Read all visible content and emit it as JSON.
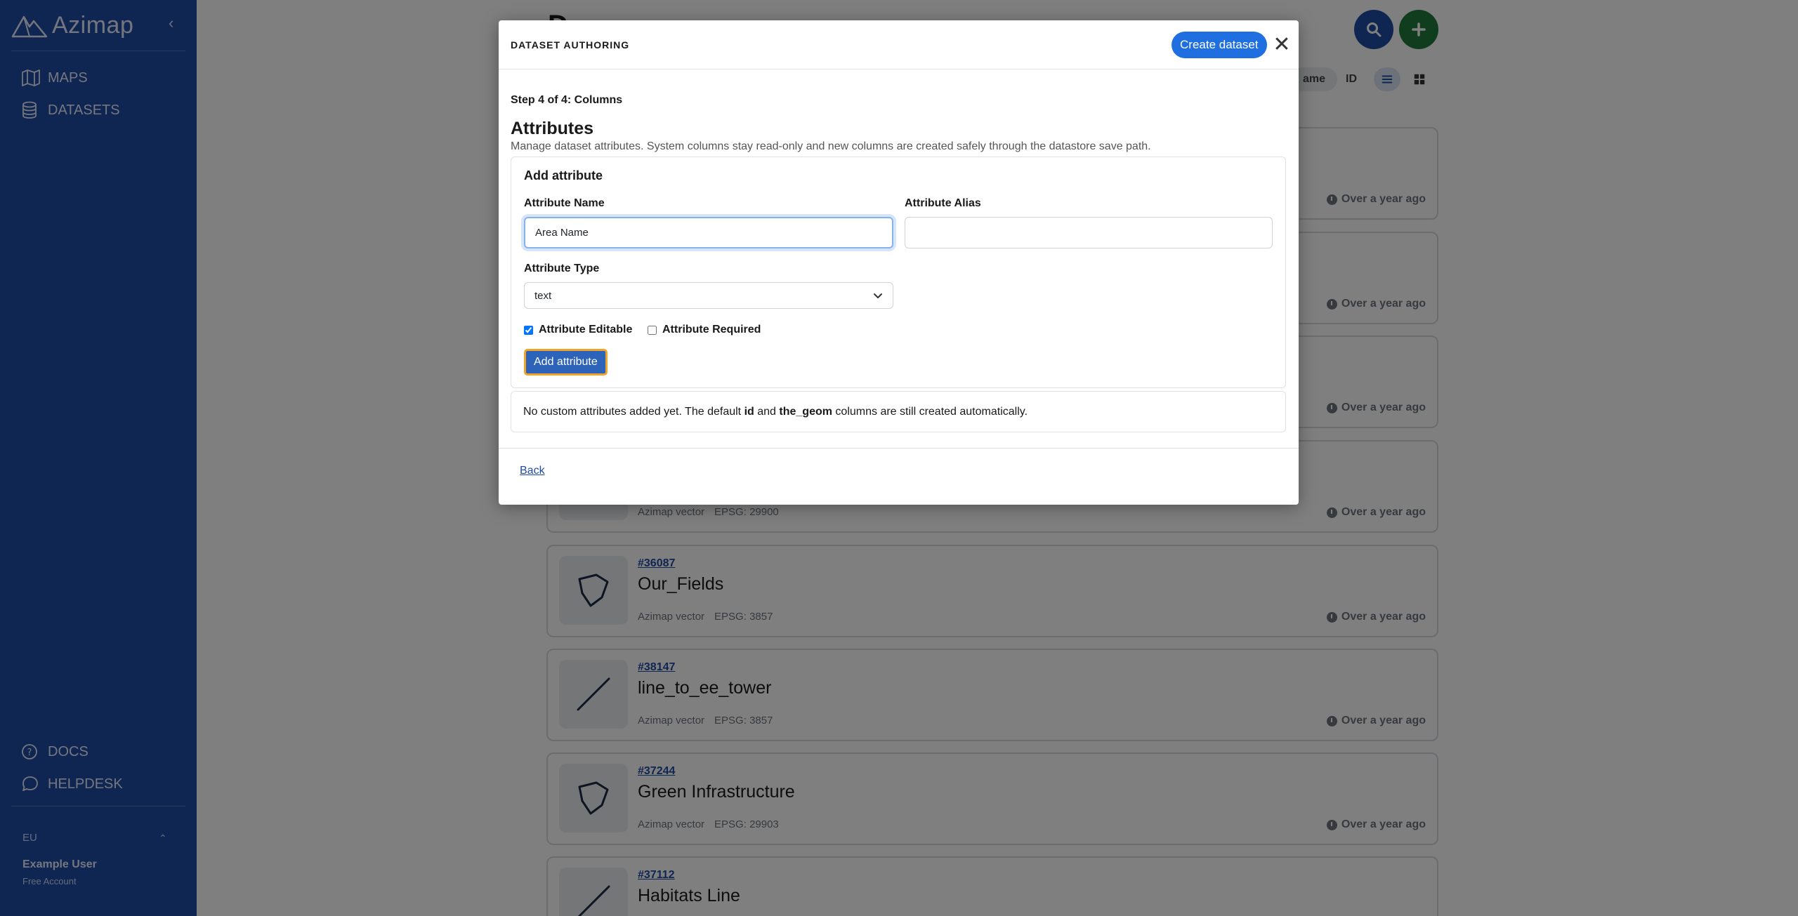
{
  "sidebar": {
    "brand": "Azimap",
    "nav": {
      "maps": "MAPS",
      "datasets": "DATASETS",
      "docs": "DOCS",
      "helpdesk": "HELPDESK"
    },
    "region": "EU",
    "user_name": "Example User",
    "user_plan": "Free Account"
  },
  "background": {
    "sort_name": "ame",
    "sort_id": "ID",
    "cards": [
      {
        "id": "",
        "title": "",
        "source": "",
        "epsg": "",
        "time": "Over a year ago",
        "geom": "polygon"
      },
      {
        "id": "",
        "title": "",
        "source": "",
        "epsg": "",
        "time": "Over a year ago",
        "geom": "polygon"
      },
      {
        "id": "",
        "title": "",
        "source": "",
        "epsg": "",
        "time": "Over a year ago",
        "geom": "polygon"
      },
      {
        "id": "",
        "title": "",
        "source": "Azimap vector",
        "epsg": "EPSG: 29900",
        "time": "Over a year ago",
        "geom": "polygon"
      },
      {
        "id": "#36087",
        "title": "Our_Fields",
        "source": "Azimap vector",
        "epsg": "EPSG: 3857",
        "time": "Over a year ago",
        "geom": "polygon"
      },
      {
        "id": "#38147",
        "title": "line_to_ee_tower",
        "source": "Azimap vector",
        "epsg": "EPSG: 3857",
        "time": "Over a year ago",
        "geom": "line"
      },
      {
        "id": "#37244",
        "title": "Green Infrastructure",
        "source": "Azimap vector",
        "epsg": "EPSG: 29903",
        "time": "Over a year ago",
        "geom": "polygon"
      },
      {
        "id": "#37112",
        "title": "Habitats Line",
        "source": "",
        "epsg": "",
        "time": "",
        "geom": "line"
      }
    ]
  },
  "modal": {
    "title": "DATASET AUTHORING",
    "create_label": "Create dataset",
    "close_glyph": "✕",
    "step": "Step 4 of 4: Columns",
    "section_title": "Attributes",
    "section_desc": "Manage dataset attributes. System columns stay read-only and new columns are created safely through the datastore save path.",
    "panel_title": "Add attribute",
    "name_label": "Attribute Name",
    "name_value": "Area Name",
    "alias_label": "Attribute Alias",
    "alias_value": "",
    "type_label": "Attribute Type",
    "type_value": "text",
    "editable_label": "Attribute Editable",
    "editable_checked": true,
    "required_label": "Attribute Required",
    "required_checked": false,
    "add_label": "Add attribute",
    "note_prefix": "No custom attributes added yet. The default",
    "note_id": "id",
    "note_and": "and",
    "note_geom": "the_geom",
    "note_suffix": "columns are still created automatically.",
    "back_label": "Back"
  },
  "colors": {
    "sidebar": "#1f4aa5",
    "primary": "#1f6fe0",
    "add_green": "#1e7a3d",
    "focus_ring": "#f0a52a"
  }
}
